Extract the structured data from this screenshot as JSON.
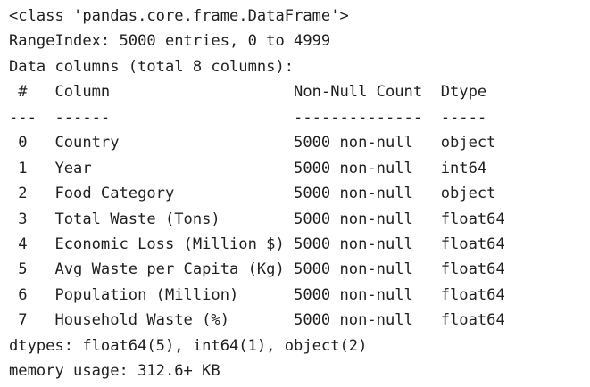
{
  "output": {
    "lines": [
      "<class 'pandas.core.frame.DataFrame'>",
      "RangeIndex: 5000 entries, 0 to 4999",
      "Data columns (total 8 columns):",
      " #   Column                    Non-Null Count  Dtype  ",
      "---  ------                    --------------  -----  ",
      " 0   Country                   5000 non-null   object ",
      " 1   Year                      5000 non-null   int64  ",
      " 2   Food Category             5000 non-null   object ",
      " 3   Total Waste (Tons)        5000 non-null   float64",
      " 4   Economic Loss (Million $) 5000 non-null   float64",
      " 5   Avg Waste per Capita (Kg) 5000 non-null   float64",
      " 6   Population (Million)      5000 non-null   float64",
      " 7   Household Waste (%)       5000 non-null   float64",
      "dtypes: float64(5), int64(1), object(2)",
      "memory usage: 312.6+ KB"
    ]
  }
}
